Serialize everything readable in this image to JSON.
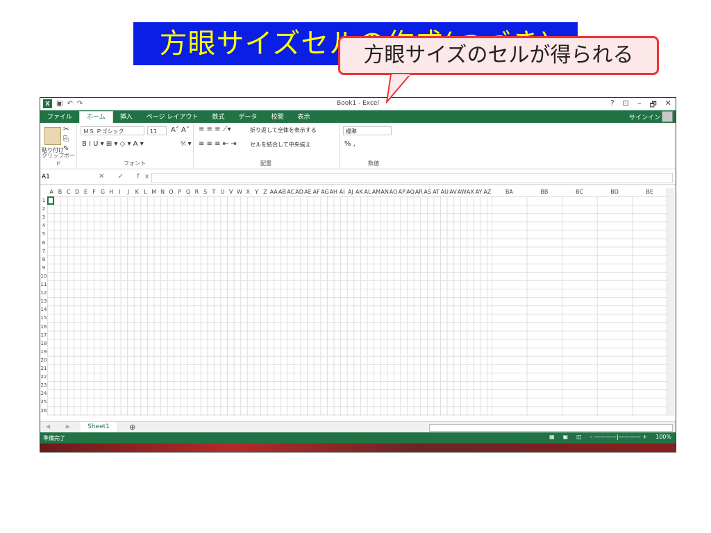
{
  "slide": {
    "title": "方眼サイズセルの作成(つづき)"
  },
  "callout": {
    "text": "方眼サイズのセルが得られる"
  },
  "window": {
    "title": "Book1 - Excel",
    "app_logo": "X",
    "controls": [
      "?",
      "⊡",
      "–",
      "🗗",
      "✕"
    ],
    "sign_in": "サインイン"
  },
  "tabs": [
    "ファイル",
    "ホーム",
    "挿入",
    "ページ レイアウト",
    "数式",
    "データ",
    "校閲",
    "表示"
  ],
  "ribbon": {
    "clipboard": {
      "label": "クリップボード",
      "paste": "貼り付け"
    },
    "font": {
      "label": "フォント",
      "name": "ＭＳ Ｐゴシック",
      "size": "11",
      "row1_extra": "A˄ A˅",
      "row2": "B I U ▾ ⊞ ▾ ◇ ▾ A ▾ ",
      "row2_extra": "ᵃ⁄ᵢ ▾"
    },
    "alignment": {
      "label": "配置",
      "wrap": "折り返して全体を表示する",
      "merge": "セルを結合して中央揃え"
    },
    "number": {
      "label": "数値",
      "format": "標準",
      "row2": "% ,"
    }
  },
  "formula_bar": {
    "name_box": "A1",
    "icons": "✕ ✓ fx"
  },
  "columns": [
    "A",
    "B",
    "C",
    "D",
    "E",
    "F",
    "G",
    "H",
    "I",
    "J",
    "K",
    "L",
    "M",
    "N",
    "O",
    "P",
    "Q",
    "R",
    "S",
    "T",
    "U",
    "V",
    "W",
    "X",
    "Y",
    "Z",
    "AA",
    "AB",
    "AC",
    "AD",
    "AE",
    "AF",
    "AG",
    "AH",
    "AI",
    "AJ",
    "AK",
    "AL",
    "AM",
    "AN",
    "AO",
    "AP",
    "AQ",
    "AR",
    "AS",
    "AT",
    "AU",
    "AV",
    "AW",
    "AX",
    "AY",
    "AZ"
  ],
  "wide_columns": [
    "BA",
    "BB",
    "BC",
    "BD",
    "BE"
  ],
  "rows": [
    "1",
    "2",
    "3",
    "4",
    "5",
    "6",
    "7",
    "8",
    "9",
    "10",
    "11",
    "12",
    "13",
    "14",
    "15",
    "16",
    "17",
    "18",
    "19",
    "20",
    "21",
    "22",
    "23",
    "24",
    "25",
    "26"
  ],
  "sheet": {
    "tab": "Sheet1",
    "add": "⊕"
  },
  "status": {
    "text": "準備完了",
    "zoom": "100%"
  }
}
